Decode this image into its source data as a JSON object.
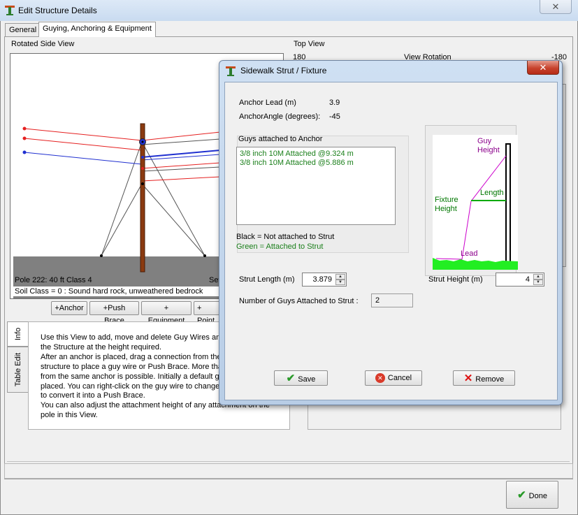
{
  "window": {
    "title": "Edit Structure Details",
    "close_glyph": "✕",
    "icon": "pole-app-icon"
  },
  "tabs": [
    {
      "label": "General",
      "active": false
    },
    {
      "label": "Guying, Anchoring & Equipment",
      "active": true
    }
  ],
  "side_view": {
    "label": "Rotated Side View",
    "pole_label": "Pole 222: 40 ft Class 4",
    "setting_label": "Setting D",
    "soil_text": "Soil Class = 0 : Sound hard rock, unweathered bedrock",
    "colors": {
      "red": "#e52020",
      "blue": "#2030d0",
      "gray": "#555555",
      "pole": "#8b3a10",
      "ground": "#808080"
    }
  },
  "toolbar": {
    "add_anchor": "+Anchor",
    "add_push_brace": "+Push Brace",
    "add_equipment": "+ Equipment",
    "add_point": "+ Point"
  },
  "top_view": {
    "label": "Top View",
    "left_value": "180",
    "rotation_label": "View Rotation",
    "right_value": "-180"
  },
  "info": {
    "tab_info": "Info",
    "tab_table_edit": "Table Edit",
    "lines": [
      "Use this View to add, move and delete Guy Wires and",
      "the Structure at the height required.",
      "After an anchor is placed, drag a connection from the",
      "structure to place a guy wire or Push Brace. More tha",
      "from the same anchor is possible. Initially a default gu",
      "placed. You can right-click on the guy wire to change",
      "to convert it into a Push Brace.",
      "You can also adjust the attachment height of any attachment on the",
      "pole in this View."
    ]
  },
  "done_button": "Done",
  "dialog": {
    "title": "Sidewalk Strut / Fixture",
    "close_glyph": "✕",
    "anchor_lead_label": "Anchor Lead (m)",
    "anchor_lead_value": "3.9",
    "anchor_angle_label": "AnchorAngle (degrees):",
    "anchor_angle_value": "-45",
    "guys_group_label": "Guys attached to Anchor",
    "guys": [
      "3/8 inch 10M Attached @9.324 m",
      "3/8 inch 10M Attached @5.886 m"
    ],
    "legend_black": "Black = Not attached to Strut",
    "legend_green": "Green = Attached to Strut",
    "diagram": {
      "guy_height": [
        "Guy",
        "Height"
      ],
      "length": "Length",
      "fixture_height": [
        "Fixture",
        "Height"
      ],
      "lead": "Lead",
      "colors": {
        "magenta": "#cc00cc",
        "green": "#00aa00",
        "ground": "#22ee22",
        "purple_text": "#8b008b",
        "green_text": "#007700"
      }
    },
    "strut_length_label": "Strut Length (m)",
    "strut_length_value": "3.879",
    "strut_height_label": "Strut Height (m)",
    "strut_height_value": "4",
    "guys_count_label": "Number of Guys Attached to Strut :",
    "guys_count_value": "2",
    "save": "Save",
    "cancel": "Cancel",
    "remove": "Remove"
  }
}
